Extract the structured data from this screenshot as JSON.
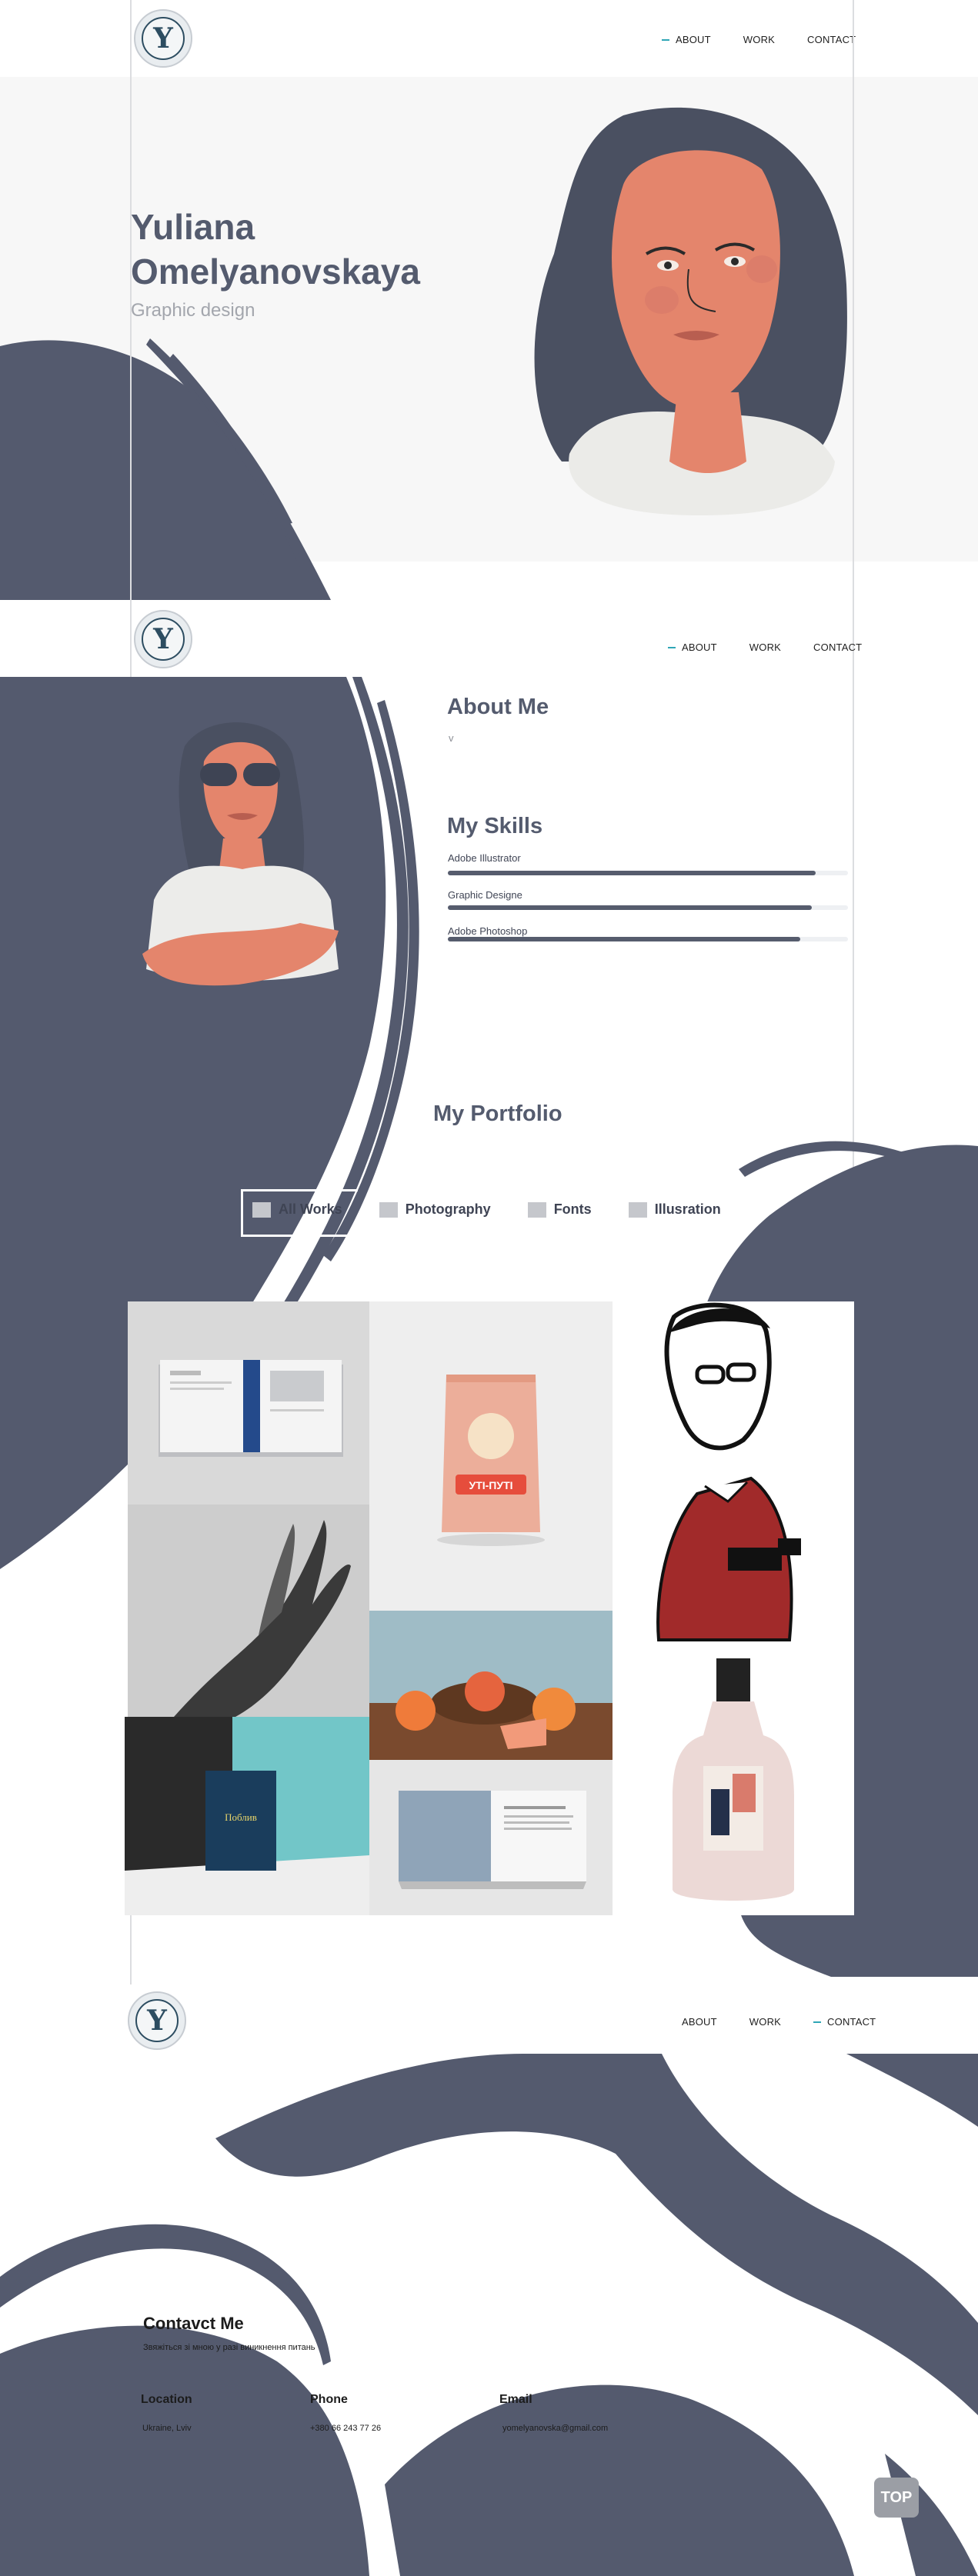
{
  "brand": {
    "logo_letter": "Y"
  },
  "header1": {
    "nav": [
      "ABOUT",
      "WORK",
      "CONTACT"
    ]
  },
  "hero": {
    "name_line1": "Yuliana",
    "name_line2": "Omelyanovskaya",
    "subtitle": "Graphic design"
  },
  "header2": {
    "nav": [
      "ABOUT",
      "WORK",
      "CONTACT"
    ]
  },
  "about": {
    "title": "About Me",
    "text": "v",
    "skills_title": "My Skills",
    "skills": [
      {
        "label": "Adobe Illustrator",
        "level": 0.92
      },
      {
        "label": "Graphic Designe",
        "level": 0.91
      },
      {
        "label": "Adobe Photoshop",
        "level": 0.88
      }
    ]
  },
  "portfolio": {
    "title": "My Portfolio",
    "tabs": [
      "All Works",
      "Photography",
      "Fonts",
      "Illusration"
    ],
    "pack_text": "УТІ-ПУТІ",
    "book_text": "Поблив"
  },
  "header3": {
    "nav": [
      "ABOUT",
      "WORK",
      "CONTACT"
    ]
  },
  "contact": {
    "title": "Contavct Me",
    "subtitle": "Звяжіться зі мною у разі виникнення питань",
    "location_label": "Location",
    "location_value": "Ukraine, Lviv",
    "phone_label": "Phone",
    "phone_value": "+380 66 243 77 26",
    "email_label": "Email",
    "email_value": "yomelyanovska@gmail.com"
  },
  "top_button": "TOP",
  "colors": {
    "slate": "#545a6e",
    "accent": "#2fa6b6",
    "hero_bg": "#f7f7f7"
  }
}
